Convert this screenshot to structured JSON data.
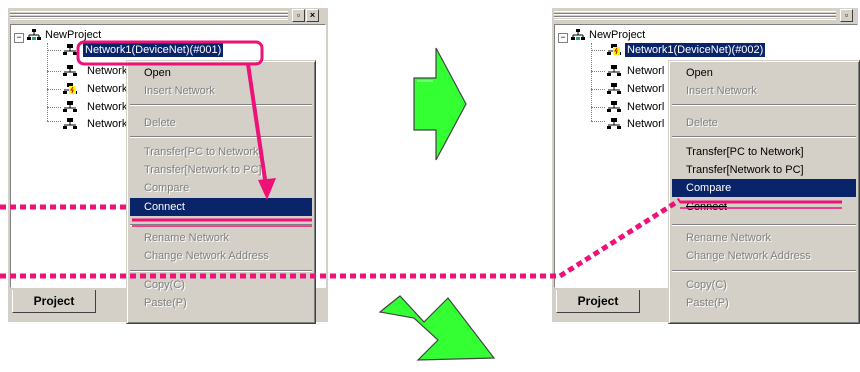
{
  "left": {
    "tree_root": "NewProject",
    "tree_selected": "Network1(DeviceNet)(#00",
    "tree_selected_tail": "1)",
    "tree_items": [
      "Network",
      "Network",
      "Network",
      "Network"
    ],
    "tab_label": "Project",
    "menu": {
      "open": "Open",
      "insert_network": "Insert Network",
      "delete": "Delete",
      "transfer_pc_to_network": "Transfer[PC to Network]",
      "transfer_network_to_pc": "Transfer[Network to PC]",
      "compare": "Compare",
      "connect": "Connect",
      "rename_network": "Rename Network",
      "change_network_address": "Change Network Address",
      "copy": "Copy(C)",
      "paste": "Paste(P)"
    }
  },
  "right": {
    "tree_root": "NewProject",
    "tree_selected": "Network1(DeviceNet)(#002)",
    "tree_items": [
      "Networl",
      "Networl",
      "Networl",
      "Networl"
    ],
    "tab_label": "Project",
    "menu": {
      "open": "Open",
      "insert_network": "Insert Network",
      "delete": "Delete",
      "transfer_pc_to_network": "Transfer[PC to Network]",
      "transfer_network_to_pc": "Transfer[Network to PC]",
      "compare": "Compare",
      "connect": "Connect",
      "rename_network": "Rename Network",
      "change_network_address": "Change Network Address",
      "copy": "Copy(C)",
      "paste": "Paste(P)"
    }
  },
  "colors": {
    "callout_magenta": "#ee1177",
    "arrow_green": "#33ff33",
    "selection_navy": "#0a246a"
  }
}
